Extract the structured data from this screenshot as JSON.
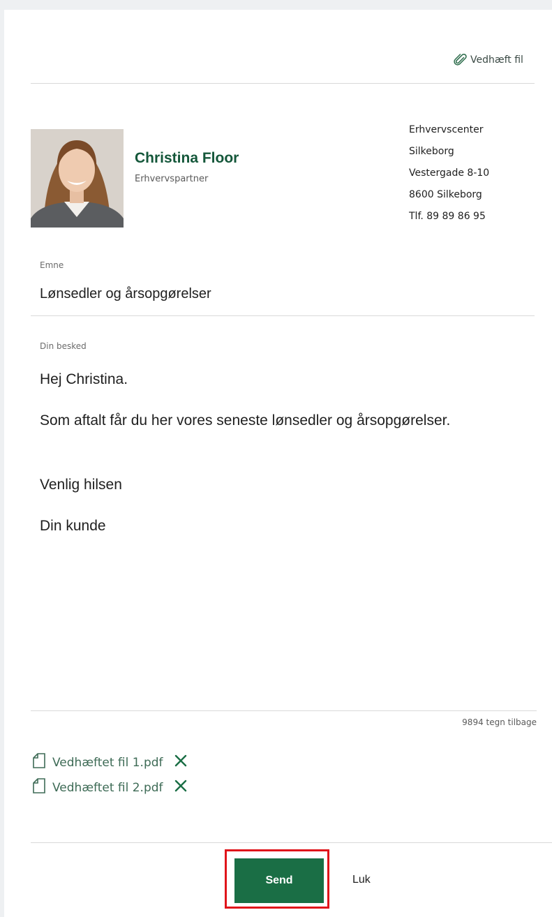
{
  "header": {
    "attach_label": "Vedhæft fil",
    "attach_icon": "paperclip-icon"
  },
  "contact": {
    "name": "Christina Floor",
    "role": "Erhvervspartner",
    "address": [
      "Erhvervscenter",
      "Silkeborg",
      "Vestergade 8-10",
      "8600 Silkeborg",
      "Tlf. 89 89 86 95"
    ]
  },
  "subject": {
    "label": "Emne",
    "value": "Lønsedler og årsopgørelser"
  },
  "message": {
    "label": "Din besked",
    "lines": [
      "Hej Christina.",
      "Som aftalt får du her vores seneste lønsedler og årsopgørelser.",
      "Venlig hilsen",
      "Din kunde"
    ],
    "remaining": "9894 tegn tilbage"
  },
  "attachments": [
    {
      "name": "Vedhæftet fil 1.pdf",
      "icon": "file-icon",
      "remove_icon": "close-icon"
    },
    {
      "name": "Vedhæftet fil 2.pdf",
      "icon": "file-icon",
      "remove_icon": "close-icon"
    }
  ],
  "actions": {
    "send_label": "Send",
    "close_label": "Luk"
  },
  "colors": {
    "brand_green": "#1a6e45",
    "name_green": "#14573a",
    "highlight_red": "#e0141a"
  }
}
